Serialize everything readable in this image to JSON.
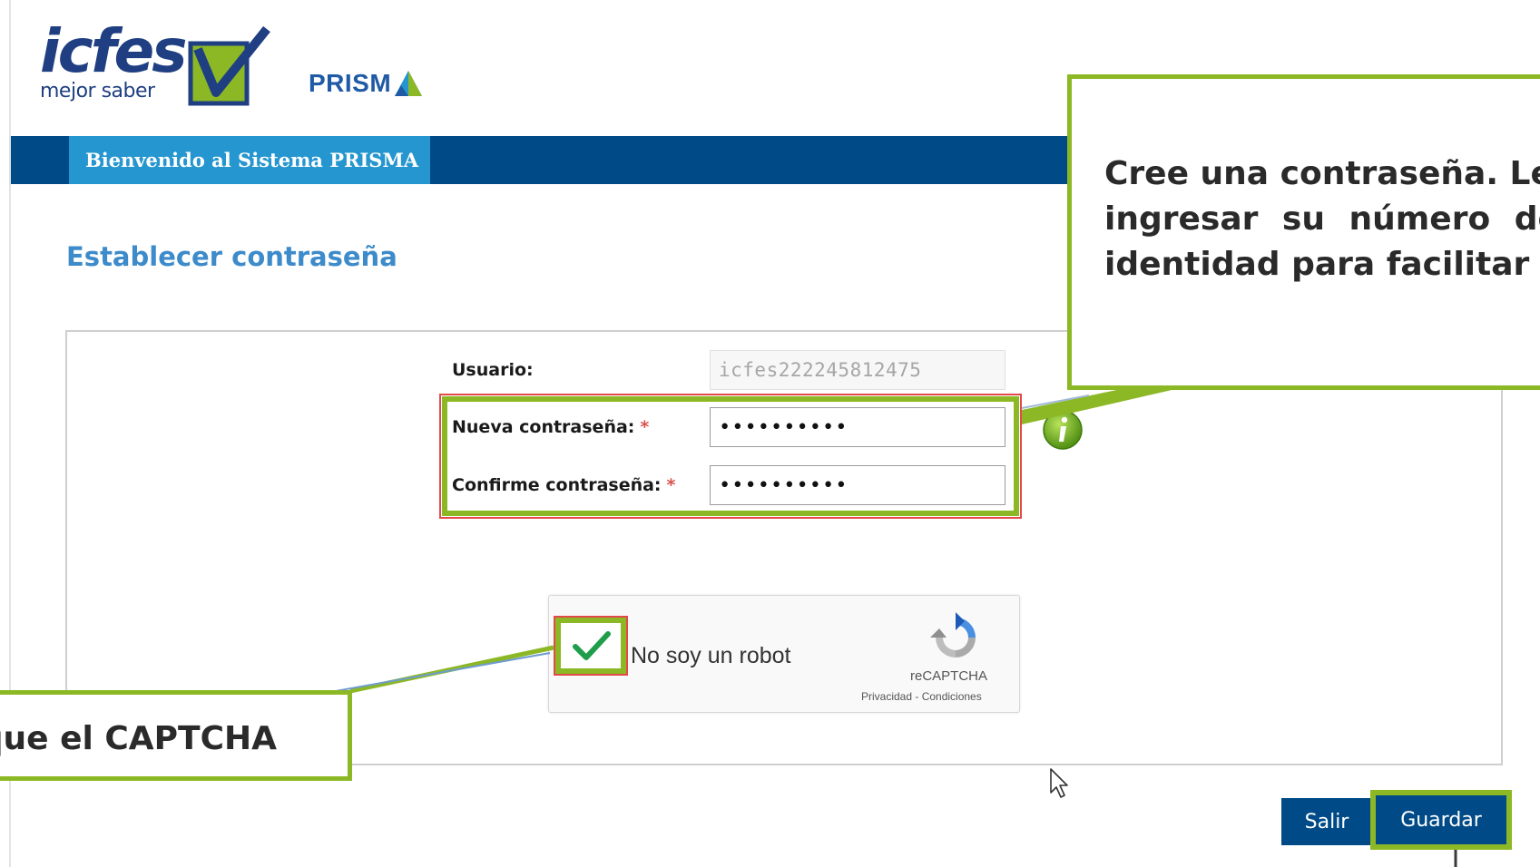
{
  "brand": {
    "logo_word": "icfes",
    "logo_tagline": "mejor saber",
    "product": "PRISM"
  },
  "nav": {
    "active_tab": "Bienvenido al Sistema PRISMA"
  },
  "page": {
    "title": "Establecer contraseña"
  },
  "form": {
    "username_label": "Usuario:",
    "username_value": "icfes222245812475",
    "new_password_label": "Nueva contraseña:",
    "new_password_value": "••••••••••",
    "confirm_password_label": "Confirme contraseña:",
    "confirm_password_value": "••••••••••",
    "required_mark": "*"
  },
  "captcha": {
    "label": "No soy un robot",
    "brand": "reCAPTCHA",
    "links": "Privacidad - Condiciones",
    "checked": true
  },
  "buttons": {
    "exit": "Salir",
    "save": "Guardar"
  },
  "callouts": {
    "password_lines": [
      "Cree una contraseña. Le r",
      "ingresar su número de d",
      "identidad para facilitar el"
    ],
    "captcha_text": "que el CAPTCHA"
  },
  "colors": {
    "navbar": "#004b87",
    "nav_tab": "#2596cf",
    "title": "#3d8bca",
    "highlight": "#8cb825",
    "required": "#d9534f"
  }
}
